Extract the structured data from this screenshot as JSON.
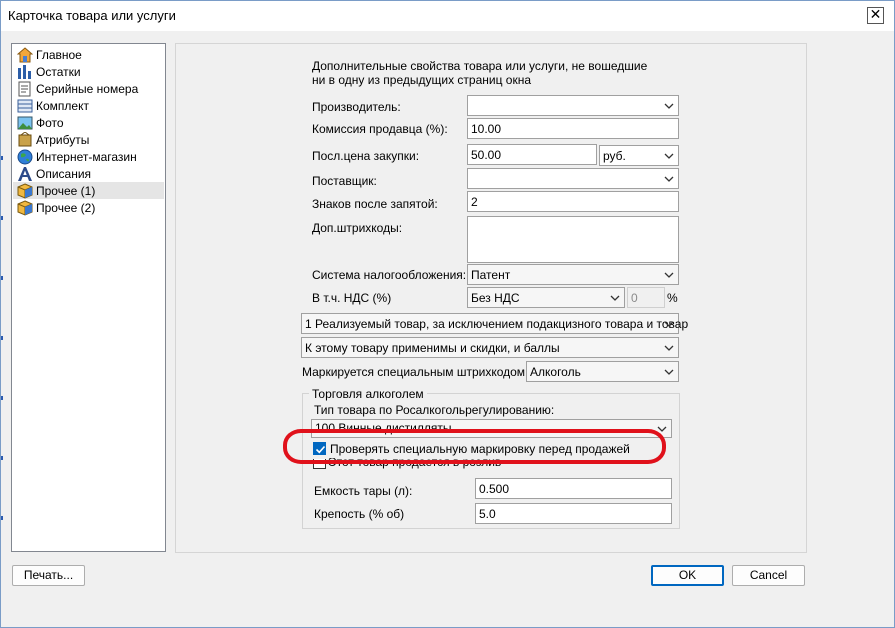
{
  "window": {
    "title": "Карточка товара или услуги",
    "close_glyph": "✕"
  },
  "nav": {
    "items": [
      {
        "label": "Главное",
        "icon": "home-icon"
      },
      {
        "label": "Остатки",
        "icon": "stock-chart-icon"
      },
      {
        "label": "Серийные номера",
        "icon": "serial-numbers-icon"
      },
      {
        "label": "Комплект",
        "icon": "kit-icon"
      },
      {
        "label": "Фото",
        "icon": "photo-icon"
      },
      {
        "label": "Атрибуты",
        "icon": "attributes-icon"
      },
      {
        "label": "Интернет-магазин",
        "icon": "globe-icon"
      },
      {
        "label": "Описания",
        "icon": "font-letter-icon"
      },
      {
        "label": "Прочее (1)",
        "icon": "box-icon",
        "selected": true
      },
      {
        "label": "Прочее (2)",
        "icon": "box-icon"
      }
    ]
  },
  "panel": {
    "description_line1": "Дополнительные свойства товара или услуги, не вошедшие",
    "description_line2": "ни в одну из предыдущих страниц окна",
    "manufacturer_label": "Производитель:",
    "manufacturer_value": "",
    "commission_label": "Комиссия продавца (%):",
    "commission_value": "10.00",
    "last_price_label": "Посл.цена закупки:",
    "last_price_value": "50.00",
    "currency_value": "руб.",
    "supplier_label": "Поставщик:",
    "supplier_value": "",
    "decimals_label": "Знаков после запятой:",
    "decimals_value": "2",
    "barcodes_label": "Доп.штрихкоды:",
    "barcodes_value": "",
    "tax_system_label": "Система налогообложения:",
    "tax_system_value": "Патент",
    "vat_label": "В т.ч. НДС (%)",
    "vat_value": "Без НДС",
    "vat_rate_value": "0",
    "vat_percent_sign": "%",
    "product_type_value": "1 Реализуемый товар, за исключением подакцизного товара и товар",
    "discounts_value": "К этому товару применимы и скидки, и баллы",
    "special_barcode_label": "Маркируется специальным штрихкодом:",
    "special_barcode_value": "Алкоголь"
  },
  "alcohol": {
    "group_title": "Торговля алкоголем",
    "type_label": "Тип товара по Росалкогольрегулированию:",
    "type_value": "100 Винные дистилляты",
    "check_marking_label": "Проверять специальную маркировку перед продажей",
    "check_marking_checked": true,
    "draft_label": "Этот товар продается в розлив",
    "draft_checked": false,
    "volume_label": "Емкость тары (л):",
    "volume_value": "0.500",
    "strength_label": "Крепость (% об)",
    "strength_value": "5.0"
  },
  "buttons": {
    "print": "Печать...",
    "ok": "OK",
    "cancel": "Cancel"
  },
  "colors": {
    "accent": "#0067c0",
    "highlight": "#e0111b",
    "window_bg": "#f0f0f0"
  }
}
